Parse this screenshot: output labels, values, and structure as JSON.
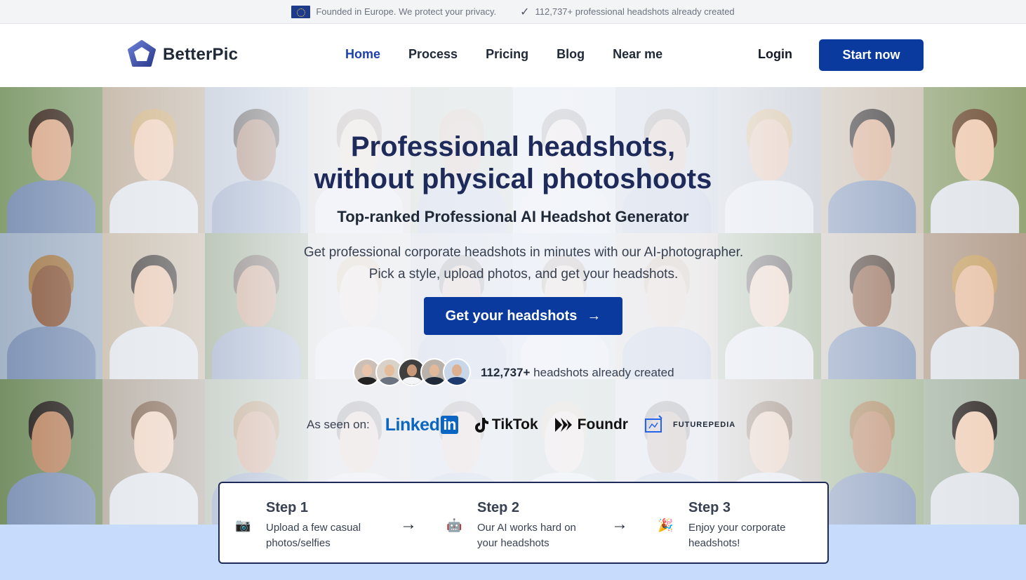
{
  "topbar": {
    "eu_text": "Founded in Europe. We protect your privacy.",
    "count_text": "112,737+ professional headshots already created"
  },
  "nav": {
    "brand": "BetterPic",
    "items": [
      "Home",
      "Process",
      "Pricing",
      "Blog",
      "Near me"
    ],
    "active": "Home",
    "login": "Login",
    "start": "Start now"
  },
  "hero": {
    "title_line1": "Professional headshots,",
    "title_line2": "without physical photoshoots",
    "subtitle": "Top-ranked Professional AI Headshot Generator",
    "description": "Get professional corporate headshots in minutes with our AI-photographer. Pick a style, upload photos, and get your headshots.",
    "cta": "Get your headshots",
    "count_bold": "112,737+",
    "count_rest": " headshots already created",
    "seen_label": "As seen on:",
    "logos": {
      "linkedin_word": "Linked",
      "linkedin_in": "in",
      "tiktok": "TikTok",
      "foundr": "Foundr",
      "futurepedia": "FUTUREPEDIA"
    }
  },
  "steps": [
    {
      "title": "Step 1",
      "text": "Upload a few casual photos/selfies",
      "icon": "camera-icon"
    },
    {
      "title": "Step 2",
      "text": "Our AI works hard on your headshots",
      "icon": "robot-icon"
    },
    {
      "title": "Step 3",
      "text": "Enjoy your corporate headshots!",
      "icon": "party-popper-icon"
    }
  ],
  "colors": {
    "primary": "#0a3a9e",
    "title": "#1e2a5a",
    "band": "#c7dbfc"
  }
}
